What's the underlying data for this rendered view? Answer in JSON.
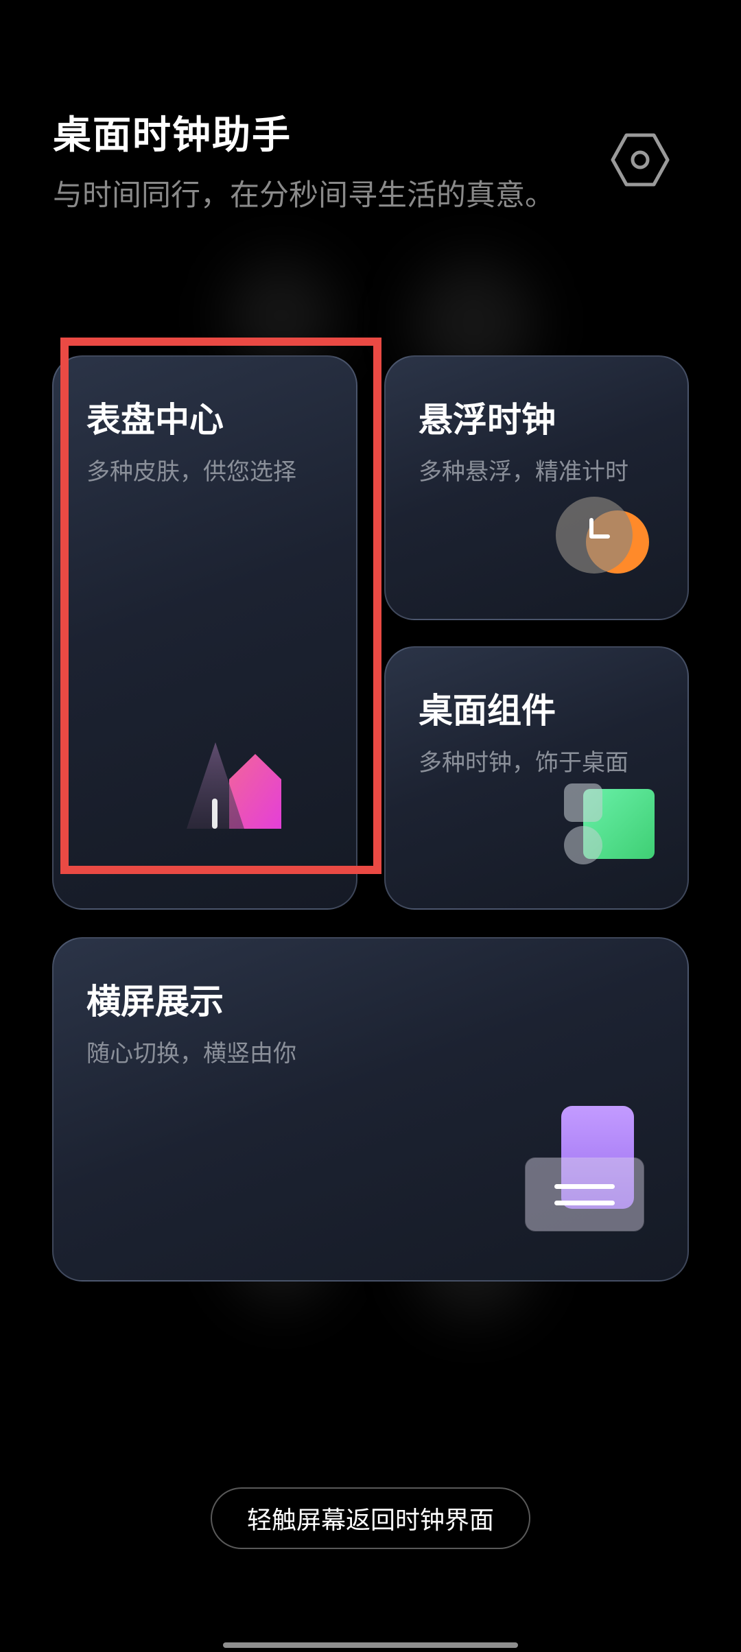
{
  "header": {
    "title": "桌面时钟助手",
    "subtitle": "与时间同行，在分秒间寻生活的真意。",
    "settings_icon": "hexagon-gear-icon"
  },
  "cards": {
    "dial_center": {
      "title": "表盘中心",
      "subtitle": "多种皮肤，供您选择",
      "icon": "dial-shapes-icon"
    },
    "floating_clock": {
      "title": "悬浮时钟",
      "subtitle": "多种悬浮，精准计时",
      "icon": "floating-clock-icon"
    },
    "desktop_widget": {
      "title": "桌面组件",
      "subtitle": "多种时钟，饰于桌面",
      "icon": "widget-blocks-icon"
    },
    "landscape": {
      "title": "横屏展示",
      "subtitle": "随心切换，横竖由你",
      "icon": "landscape-device-icon"
    }
  },
  "bottom": {
    "label": "轻触屏幕返回时钟界面"
  },
  "colors": {
    "highlight": "#ea4a44",
    "pink": "#e84fc0",
    "orange": "#ff8a2a",
    "green": "#4fe08a",
    "purple": "#b58cf5"
  }
}
